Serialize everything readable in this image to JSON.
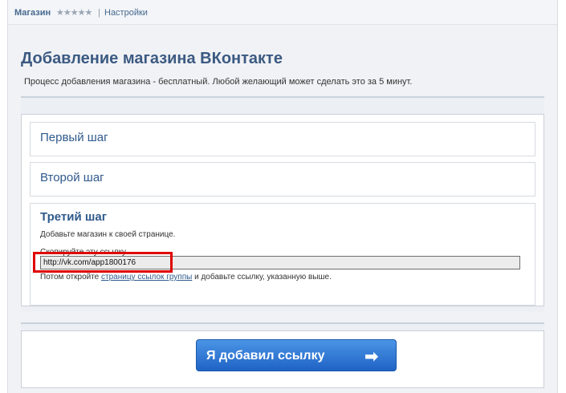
{
  "breadcrumb": {
    "app": "Магазин",
    "stars": "★★★★★",
    "separator": "|",
    "settings": "Настройки"
  },
  "heading": "Добавление магазина ВКонтакте",
  "subheading": "Процесс добавления магазина - бесплатный. Любой желающий может сделать это за 5 минут.",
  "steps": [
    {
      "title": "Первый шаг"
    },
    {
      "title": "Второй шаг"
    },
    {
      "title": "Третий шаг",
      "description": "Добавьте магазин к своей странице.",
      "copy_label": "Скопируйте эту ссылку",
      "link_value": "http://vk.com/app1800176",
      "after_text_before": "Потом откройте ",
      "after_link": "страницу ссылок группы",
      "after_text_after": " и добавьте ссылку, указанную выше."
    }
  ],
  "button": {
    "label": "Я добавил ссылку",
    "icon": "arrow-right-icon"
  },
  "colors": {
    "accent": "#2f5a8c",
    "highlight": "#e00000",
    "button": "#2f7bd8"
  }
}
